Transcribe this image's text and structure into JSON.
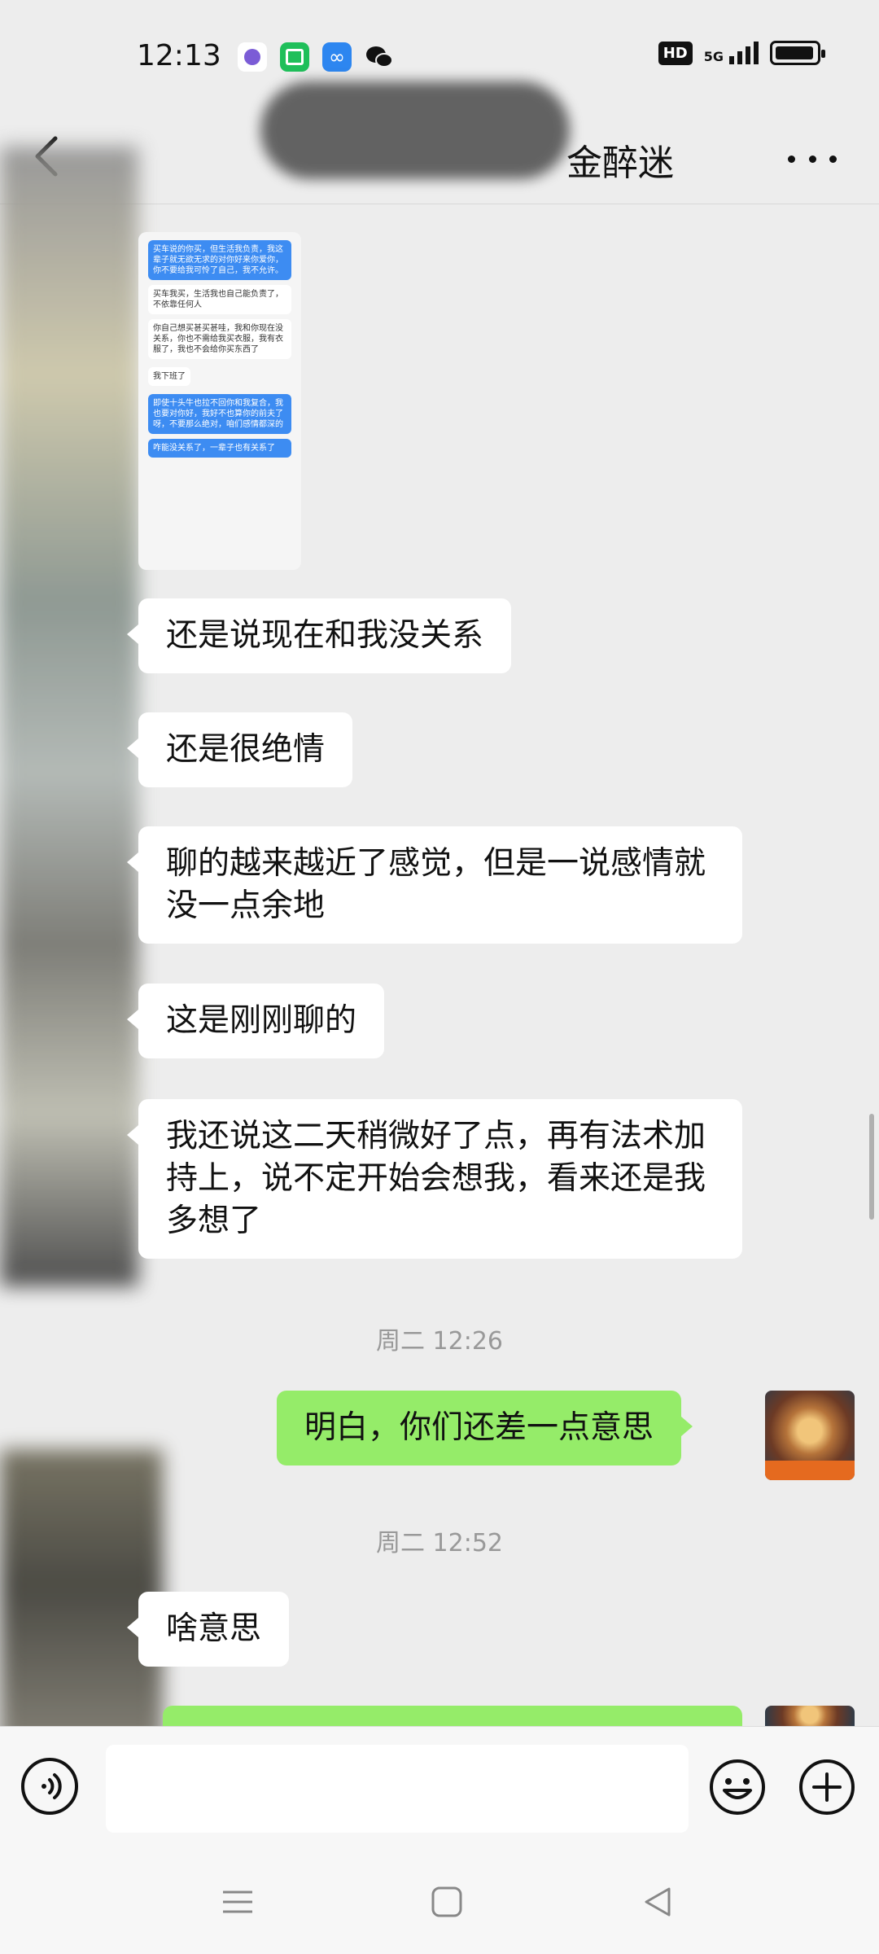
{
  "status_bar": {
    "time": "12:13",
    "network": "5G",
    "hd": "HD"
  },
  "header": {
    "title": "金醉迷"
  },
  "image_message": {
    "lines": [
      {
        "text": "买车说的你买，但生活我负责，我这辈子就无欲无求的对你好来你爱你，你不要给我可怜了自己，我不允许。",
        "style": "b"
      },
      {
        "text": "买车我买，生活我也自己能负责了，不依靠任何人",
        "style": "w"
      },
      {
        "text": "你自己想买甚买甚哇，我和你现在没关系，你也不需给我买衣服，我有衣服了，我也不会给你买东西了",
        "style": "w"
      },
      {
        "text": "我下班了",
        "style": "w"
      },
      {
        "text": "即使十头牛也拉不回你和我复合，我也要对你好，我好不也算你的前夫了呀，不要那么绝对，咱们感情都深的",
        "style": "b"
      },
      {
        "text": "咋能没关系了，一辈子也有关系了",
        "style": "b"
      }
    ]
  },
  "messages": [
    {
      "side": "in",
      "text": "还是说现在和我没关系"
    },
    {
      "side": "in",
      "text": "还是很绝情"
    },
    {
      "side": "in",
      "text": "聊的越来越近了感觉，但是一说感情就没一点余地"
    },
    {
      "side": "in",
      "text": "这是刚刚聊的"
    },
    {
      "side": "in",
      "text": "我还说这二天稍微好了点，再有法术加持上，说不定开始会想我，看来还是我多想了"
    },
    {
      "side": "time",
      "text": "周二 12:26"
    },
    {
      "side": "out",
      "text": "明白，你们还差一点意思"
    },
    {
      "side": "time",
      "text": "周二 12:52"
    },
    {
      "side": "in",
      "text": "啥意思"
    }
  ],
  "input": {
    "placeholder": ""
  },
  "colors": {
    "bg": "#ededed",
    "out_bubble": "#95ec69",
    "in_bubble": "#ffffff"
  },
  "icons": [
    "back-icon",
    "more-icon",
    "voice-icon",
    "emoji-icon",
    "plus-icon",
    "nav-menu-icon",
    "nav-home-icon",
    "nav-back-icon"
  ]
}
